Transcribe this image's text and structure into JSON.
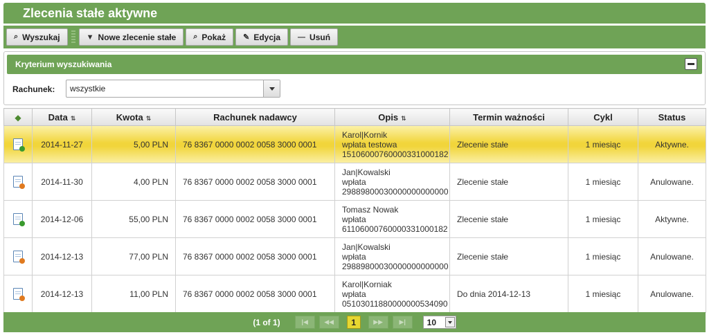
{
  "title": "Zlecenia stałe aktywne",
  "toolbar": {
    "search": "Wyszukaj",
    "new_order": "Nowe zlecenie stałe",
    "show": "Pokaż",
    "edit": "Edycja",
    "delete": "Usuń"
  },
  "search_panel": {
    "header": "Kryterium wyszukiwania",
    "account_label": "Rachunek:",
    "account_value": "wszystkie"
  },
  "table": {
    "headers": {
      "date": "Data",
      "amount": "Kwota",
      "sender_account": "Rachunek nadawcy",
      "description": "Opis",
      "validity": "Termin ważności",
      "cycle": "Cykl",
      "status": "Status"
    },
    "rows": [
      {
        "status_icon": "document-ok-icon",
        "date": "2014-11-27",
        "amount": "5,00 PLN",
        "account": "76 8367 0000 0002 0058 3000 0001",
        "desc1": "Karol|Kornik",
        "desc2": "wpłata testowa",
        "desc3": "15106000760000331000182",
        "validity": "Zlecenie stałe",
        "cycle": "1 miesiąc",
        "status": "Aktywne."
      },
      {
        "status_icon": "document-cancel-icon",
        "date": "2014-11-30",
        "amount": "4,00 PLN",
        "account": "76 8367 0000 0002 0058 3000 0001",
        "desc1": "Jan|Kowalski",
        "desc2": "wpłata",
        "desc3": "29889800030000000000000",
        "validity": "Zlecenie stałe",
        "cycle": "1 miesiąc",
        "status": "Anulowane."
      },
      {
        "status_icon": "document-ok-icon",
        "date": "2014-12-06",
        "amount": "55,00 PLN",
        "account": "76 8367 0000 0002 0058 3000 0001",
        "desc1": "Tomasz Nowak",
        "desc2": "wpłata",
        "desc3": "61106000760000331000182",
        "validity": "Zlecenie stałe",
        "cycle": "1 miesiąc",
        "status": "Aktywne."
      },
      {
        "status_icon": "document-cancel-icon",
        "date": "2014-12-13",
        "amount": "77,00 PLN",
        "account": "76 8367 0000 0002 0058 3000 0001",
        "desc1": "Jan|Kowalski",
        "desc2": "wpłata",
        "desc3": "29889800030000000000000",
        "validity": "Zlecenie stałe",
        "cycle": "1 miesiąc",
        "status": "Anulowane."
      },
      {
        "status_icon": "document-cancel-icon",
        "date": "2014-12-13",
        "amount": "11,00 PLN",
        "account": "76 8367 0000 0002 0058 3000 0001",
        "desc1": "Karol|Korniak",
        "desc2": "wpłata",
        "desc3": "05103011880000000534090",
        "validity": "Do dnia 2014-12-13",
        "cycle": "1 miesiąc",
        "status": "Anulowane."
      }
    ]
  },
  "pager": {
    "info": "(1 of 1)",
    "current_page": "1",
    "page_size": "10"
  },
  "colors": {
    "accent_green": "#6fa356",
    "selected_row": "#f1d53b"
  }
}
